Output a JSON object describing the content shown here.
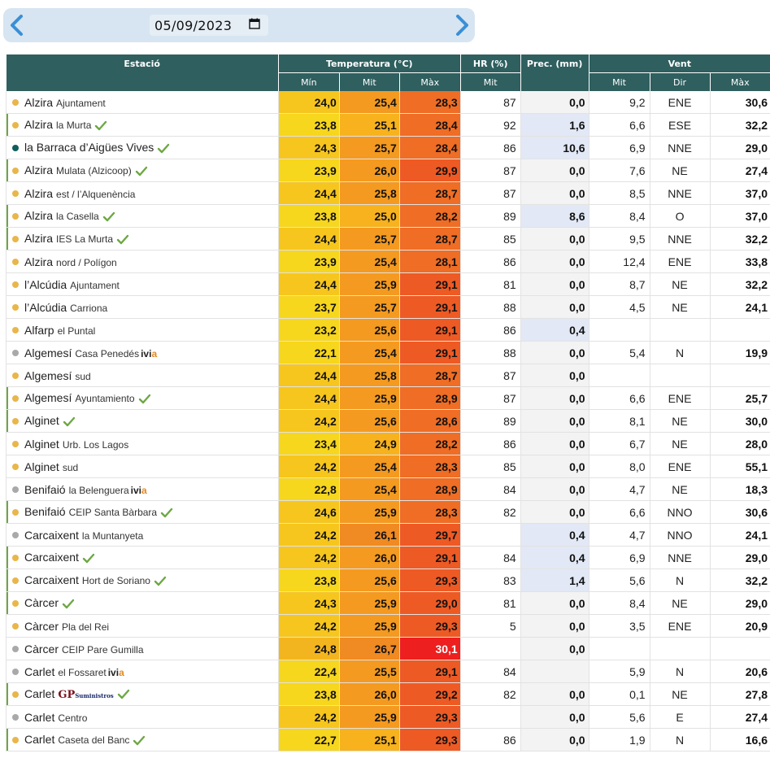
{
  "header": {
    "date_value": "05/09/2023",
    "prev_icon": "chevron-left-icon",
    "next_icon": "chevron-right-icon",
    "calendar_icon": "calendar-icon"
  },
  "columns": {
    "station": "Estació",
    "temperature": "Temperatura (°C)",
    "humidity": "HR (%)",
    "precip": "Prec. (mm)",
    "wind": "Vent",
    "t_min": "Mín",
    "t_mit": "Mit",
    "t_max": "Màx",
    "hr_mit": "Mit",
    "w_mit": "Mit",
    "w_dir": "Dir",
    "w_max": "Màx"
  },
  "colors": {
    "header_bg": "#2f5f5f",
    "status_yellow": "#e8b64a",
    "status_gray": "#a9a9a9",
    "status_teal": "#0f5f5f",
    "check_green": "#6da843"
  },
  "rows": [
    {
      "town": "Alzira",
      "loc": "Ajuntament",
      "dot": "y",
      "bar": false,
      "check": false,
      "brand": "",
      "tmin": "24,0",
      "tmit": "25,4",
      "tmax": "28,3",
      "cmin": "mn2",
      "cmit": "mt2",
      "cmax": "mx1",
      "hr": "87",
      "prec": "0,0",
      "wet": false,
      "wmit": "9,2",
      "wdir": "ENE",
      "wmax": "30,6"
    },
    {
      "town": "Alzira",
      "loc": "la Murta",
      "dot": "y",
      "bar": true,
      "check": true,
      "brand": "",
      "tmin": "23,8",
      "tmit": "25,1",
      "tmax": "28,4",
      "cmin": "mn1",
      "cmit": "mt1",
      "cmax": "mx1",
      "hr": "92",
      "prec": "1,6",
      "wet": true,
      "wmit": "6,6",
      "wdir": "ESE",
      "wmax": "32,2"
    },
    {
      "town": "la Barraca d’Aigües Vives",
      "loc": "",
      "dot": "t",
      "bar": false,
      "check": true,
      "brand": "",
      "tmin": "24,3",
      "tmit": "25,7",
      "tmax": "28,4",
      "cmin": "mn2",
      "cmit": "mt2",
      "cmax": "mx1",
      "hr": "86",
      "prec": "10,6",
      "wet": true,
      "wmit": "6,9",
      "wdir": "NNE",
      "wmax": "29,0"
    },
    {
      "town": "Alzira",
      "loc": "Mulata (Alzicoop)",
      "dot": "y",
      "bar": true,
      "check": true,
      "brand": "",
      "tmin": "23,9",
      "tmit": "26,0",
      "tmax": "29,9",
      "cmin": "mn1",
      "cmit": "mt2",
      "cmax": "mx2",
      "hr": "87",
      "prec": "0,0",
      "wet": false,
      "wmit": "7,6",
      "wdir": "NE",
      "wmax": "27,4"
    },
    {
      "town": "Alzira",
      "loc": "est / l’Alquenència",
      "dot": "y",
      "bar": false,
      "check": false,
      "brand": "",
      "tmin": "24,4",
      "tmit": "25,8",
      "tmax": "28,7",
      "cmin": "mn2",
      "cmit": "mt2",
      "cmax": "mx1",
      "hr": "87",
      "prec": "0,0",
      "wet": false,
      "wmit": "8,5",
      "wdir": "NNE",
      "wmax": "37,0"
    },
    {
      "town": "Alzira",
      "loc": "la Casella",
      "dot": "y",
      "bar": true,
      "check": true,
      "brand": "",
      "tmin": "23,8",
      "tmit": "25,0",
      "tmax": "28,2",
      "cmin": "mn1",
      "cmit": "mt1",
      "cmax": "mx1",
      "hr": "89",
      "prec": "8,6",
      "wet": true,
      "wmit": "8,4",
      "wdir": "O",
      "wmax": "37,0"
    },
    {
      "town": "Alzira",
      "loc": "IES La Murta",
      "dot": "y",
      "bar": true,
      "check": true,
      "brand": "",
      "tmin": "24,4",
      "tmit": "25,7",
      "tmax": "28,7",
      "cmin": "mn2",
      "cmit": "mt2",
      "cmax": "mx1",
      "hr": "85",
      "prec": "0,0",
      "wet": false,
      "wmit": "9,5",
      "wdir": "NNE",
      "wmax": "32,2"
    },
    {
      "town": "Alzira",
      "loc": "nord / Polígon",
      "dot": "y",
      "bar": false,
      "check": false,
      "brand": "",
      "tmin": "23,9",
      "tmit": "25,4",
      "tmax": "28,1",
      "cmin": "mn1",
      "cmit": "mt2",
      "cmax": "mx1",
      "hr": "86",
      "prec": "0,0",
      "wet": false,
      "wmit": "12,4",
      "wdir": "ENE",
      "wmax": "33,8"
    },
    {
      "town": "l’Alcúdia",
      "loc": "Ajuntament",
      "dot": "y",
      "bar": false,
      "check": false,
      "brand": "",
      "tmin": "24,4",
      "tmit": "25,9",
      "tmax": "29,1",
      "cmin": "mn2",
      "cmit": "mt2",
      "cmax": "mx2",
      "hr": "81",
      "prec": "0,0",
      "wet": false,
      "wmit": "8,7",
      "wdir": "NE",
      "wmax": "32,2"
    },
    {
      "town": "l’Alcúdia",
      "loc": "Carriona",
      "dot": "y",
      "bar": false,
      "check": false,
      "brand": "",
      "tmin": "23,7",
      "tmit": "25,7",
      "tmax": "29,1",
      "cmin": "mn1",
      "cmit": "mt2",
      "cmax": "mx2",
      "hr": "88",
      "prec": "0,0",
      "wet": false,
      "wmit": "4,5",
      "wdir": "NE",
      "wmax": "24,1"
    },
    {
      "town": "Alfarp",
      "loc": "el Puntal",
      "dot": "y",
      "bar": false,
      "check": false,
      "brand": "",
      "tmin": "23,2",
      "tmit": "25,6",
      "tmax": "29,1",
      "cmin": "mn1",
      "cmit": "mt2",
      "cmax": "mx2",
      "hr": "86",
      "prec": "0,4",
      "wet": true,
      "wmit": "",
      "wdir": "",
      "wmax": ""
    },
    {
      "town": "Algemesí",
      "loc": "Casa Penedés",
      "dot": "g",
      "bar": false,
      "check": false,
      "brand": "ivia",
      "tmin": "22,1",
      "tmit": "25,4",
      "tmax": "29,1",
      "cmin": "mn1",
      "cmit": "mt2",
      "cmax": "mx2",
      "hr": "88",
      "prec": "0,0",
      "wet": false,
      "wmit": "5,4",
      "wdir": "N",
      "wmax": "19,9"
    },
    {
      "town": "Algemesí",
      "loc": "sud",
      "dot": "y",
      "bar": false,
      "check": false,
      "brand": "",
      "tmin": "24,4",
      "tmit": "25,8",
      "tmax": "28,7",
      "cmin": "mn2",
      "cmit": "mt2",
      "cmax": "mx1",
      "hr": "87",
      "prec": "0,0",
      "wet": false,
      "wmit": "",
      "wdir": "",
      "wmax": ""
    },
    {
      "town": "Algemesí",
      "loc": "Ayuntamiento",
      "dot": "y",
      "bar": true,
      "check": true,
      "brand": "",
      "tmin": "24,4",
      "tmit": "25,9",
      "tmax": "28,9",
      "cmin": "mn2",
      "cmit": "mt2",
      "cmax": "mx1",
      "hr": "87",
      "prec": "0,0",
      "wet": false,
      "wmit": "6,6",
      "wdir": "ENE",
      "wmax": "25,7"
    },
    {
      "town": "Alginet",
      "loc": "",
      "dot": "y",
      "bar": true,
      "check": true,
      "brand": "",
      "tmin": "24,2",
      "tmit": "25,6",
      "tmax": "28,6",
      "cmin": "mn2",
      "cmit": "mt2",
      "cmax": "mx1",
      "hr": "89",
      "prec": "0,0",
      "wet": false,
      "wmit": "8,1",
      "wdir": "NE",
      "wmax": "30,0"
    },
    {
      "town": "Alginet",
      "loc": "Urb. Los Lagos",
      "dot": "y",
      "bar": false,
      "check": false,
      "brand": "",
      "tmin": "23,4",
      "tmit": "24,9",
      "tmax": "28,2",
      "cmin": "mn1",
      "cmit": "mt1",
      "cmax": "mx1",
      "hr": "86",
      "prec": "0,0",
      "wet": false,
      "wmit": "6,7",
      "wdir": "NE",
      "wmax": "28,0"
    },
    {
      "town": "Alginet",
      "loc": "sud",
      "dot": "y",
      "bar": false,
      "check": false,
      "brand": "",
      "tmin": "24,2",
      "tmit": "25,4",
      "tmax": "28,3",
      "cmin": "mn2",
      "cmit": "mt2",
      "cmax": "mx1",
      "hr": "85",
      "prec": "0,0",
      "wet": false,
      "wmit": "8,0",
      "wdir": "ENE",
      "wmax": "55,1"
    },
    {
      "town": "Benifaió",
      "loc": "la Belenguera",
      "dot": "g",
      "bar": false,
      "check": false,
      "brand": "ivia",
      "tmin": "22,8",
      "tmit": "25,4",
      "tmax": "28,9",
      "cmin": "mn1",
      "cmit": "mt2",
      "cmax": "mx1",
      "hr": "84",
      "prec": "0,0",
      "wet": false,
      "wmit": "4,7",
      "wdir": "NE",
      "wmax": "18,3"
    },
    {
      "town": "Benifaió",
      "loc": "CEIP Santa Bàrbara",
      "dot": "y",
      "bar": true,
      "check": true,
      "brand": "",
      "tmin": "24,6",
      "tmit": "25,9",
      "tmax": "28,3",
      "cmin": "mn2",
      "cmit": "mt2",
      "cmax": "mx1",
      "hr": "82",
      "prec": "0,0",
      "wet": false,
      "wmit": "6,6",
      "wdir": "NNO",
      "wmax": "30,6"
    },
    {
      "town": "Carcaixent",
      "loc": "la Muntanyeta",
      "dot": "g",
      "bar": false,
      "check": false,
      "brand": "",
      "tmin": "24,2",
      "tmit": "26,1",
      "tmax": "29,7",
      "cmin": "mn2",
      "cmit": "mt3",
      "cmax": "mx2",
      "hr": "",
      "prec": "0,4",
      "wet": true,
      "wmit": "4,7",
      "wdir": "NNO",
      "wmax": "24,1"
    },
    {
      "town": "Carcaixent",
      "loc": "",
      "dot": "y",
      "bar": true,
      "check": true,
      "brand": "",
      "tmin": "24,2",
      "tmit": "26,0",
      "tmax": "29,1",
      "cmin": "mn2",
      "cmit": "mt2",
      "cmax": "mx2",
      "hr": "84",
      "prec": "0,4",
      "wet": true,
      "wmit": "6,9",
      "wdir": "NNE",
      "wmax": "29,0"
    },
    {
      "town": "Carcaixent",
      "loc": "Hort de Soriano",
      "dot": "y",
      "bar": true,
      "check": true,
      "brand": "",
      "tmin": "23,8",
      "tmit": "25,6",
      "tmax": "29,3",
      "cmin": "mn1",
      "cmit": "mt2",
      "cmax": "mx2",
      "hr": "83",
      "prec": "1,4",
      "wet": true,
      "wmit": "5,6",
      "wdir": "N",
      "wmax": "32,2"
    },
    {
      "town": "Càrcer",
      "loc": "",
      "dot": "y",
      "bar": true,
      "check": true,
      "brand": "",
      "tmin": "24,3",
      "tmit": "25,9",
      "tmax": "29,0",
      "cmin": "mn2",
      "cmit": "mt2",
      "cmax": "mx2",
      "hr": "81",
      "prec": "0,0",
      "wet": false,
      "wmit": "8,4",
      "wdir": "NE",
      "wmax": "29,0"
    },
    {
      "town": "Càrcer",
      "loc": "Pla del Rei",
      "dot": "y",
      "bar": false,
      "check": false,
      "brand": "",
      "tmin": "24,2",
      "tmit": "25,9",
      "tmax": "29,3",
      "cmin": "mn2",
      "cmit": "mt2",
      "cmax": "mx2",
      "hr": "5",
      "prec": "0,0",
      "wet": false,
      "wmit": "3,5",
      "wdir": "ENE",
      "wmax": "20,9"
    },
    {
      "town": "Càrcer",
      "loc": "CEIP Pare Gumilla",
      "dot": "g",
      "bar": false,
      "check": false,
      "brand": "",
      "tmin": "24,8",
      "tmit": "26,7",
      "tmax": "30,1",
      "cmin": "mn3",
      "cmit": "mt3",
      "cmax": "mx3",
      "hr": "",
      "prec": "0,0",
      "wet": false,
      "wmit": "",
      "wdir": "",
      "wmax": ""
    },
    {
      "town": "Carlet",
      "loc": "el Fossaret",
      "dot": "g",
      "bar": false,
      "check": false,
      "brand": "ivia",
      "tmin": "22,4",
      "tmit": "25,5",
      "tmax": "29,1",
      "cmin": "mn1",
      "cmit": "mt2",
      "cmax": "mx2",
      "hr": "84",
      "prec": "",
      "wet": false,
      "wmit": "5,9",
      "wdir": "N",
      "wmax": "20,6"
    },
    {
      "town": "Carlet",
      "loc": "",
      "dot": "y",
      "bar": true,
      "check": true,
      "brand": "gp",
      "tmin": "23,8",
      "tmit": "26,0",
      "tmax": "29,2",
      "cmin": "mn1",
      "cmit": "mt2",
      "cmax": "mx2",
      "hr": "82",
      "prec": "0,0",
      "wet": false,
      "wmit": "0,1",
      "wdir": "NE",
      "wmax": "27,8"
    },
    {
      "town": "Carlet",
      "loc": "Centro",
      "dot": "g",
      "bar": false,
      "check": false,
      "brand": "",
      "tmin": "24,2",
      "tmit": "25,9",
      "tmax": "29,3",
      "cmin": "mn2",
      "cmit": "mt2",
      "cmax": "mx2",
      "hr": "",
      "prec": "0,0",
      "wet": false,
      "wmit": "5,6",
      "wdir": "E",
      "wmax": "27,4"
    },
    {
      "town": "Carlet",
      "loc": "Caseta del Banc",
      "dot": "y",
      "bar": true,
      "check": true,
      "brand": "",
      "tmin": "22,7",
      "tmit": "25,1",
      "tmax": "29,3",
      "cmin": "mn1",
      "cmit": "mt1",
      "cmax": "mx2",
      "hr": "86",
      "prec": "0,0",
      "wet": false,
      "wmit": "1,9",
      "wdir": "N",
      "wmax": "16,6"
    }
  ],
  "brand_text": {
    "ivia_a": "ivi",
    "ivia_b": "a",
    "gp_logo": "GP",
    "gp_sub": "Suministros"
  }
}
